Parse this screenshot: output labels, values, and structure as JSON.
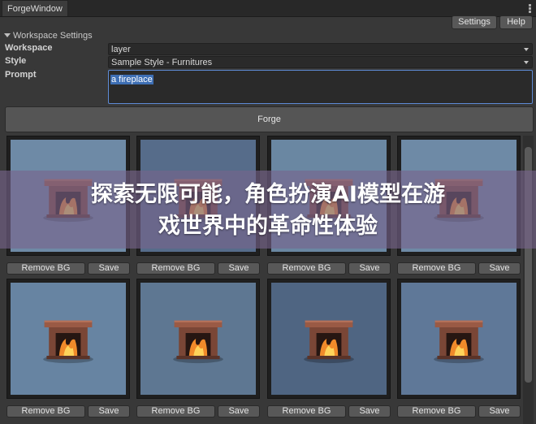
{
  "window": {
    "tab_title": "ForgeWindow"
  },
  "toolbar": {
    "settings_label": "Settings",
    "help_label": "Help"
  },
  "workspace_settings": {
    "header": "Workspace Settings",
    "workspace": {
      "label": "Workspace",
      "value": "layer"
    },
    "style": {
      "label": "Style",
      "value": "Sample Style - Furnitures"
    },
    "prompt": {
      "label": "Prompt",
      "value": "a fireplace"
    }
  },
  "forge_button_label": "Forge",
  "results": {
    "remove_bg_label": "Remove BG",
    "save_label": "Save",
    "items": [
      {
        "image": "fireplace-icon",
        "background": "#6e8aa6"
      },
      {
        "image": "fireplace-icon",
        "background": "#566c8a"
      },
      {
        "image": "fireplace-icon",
        "background": "#6a87a2"
      },
      {
        "image": "fireplace-icon",
        "background": "#6e8aa6"
      },
      {
        "image": "fireplace-icon",
        "background": "#6784a2"
      },
      {
        "image": "fireplace-icon",
        "background": "#5e7792"
      },
      {
        "image": "fireplace-icon",
        "background": "#4f6582"
      },
      {
        "image": "fireplace-icon",
        "background": "#5f7898"
      }
    ]
  },
  "overlay": {
    "line1": "探索无限可能，角色扮演AI模型在游",
    "line2": "戏世界中的革命性体验"
  },
  "colors": {
    "panel": "#383838",
    "selection": "#3e6fb4",
    "overlay": "#78648c"
  }
}
